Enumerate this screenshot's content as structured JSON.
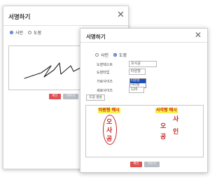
{
  "back_dialog": {
    "title": "서명하기",
    "radio_sign": "사인",
    "radio_stamp": "도장",
    "confirm_label": "확인",
    "clear_label": "지우기"
  },
  "front_dialog": {
    "title": "서명하기",
    "radio_sign": "사인",
    "radio_stamp": "도장",
    "fields": {
      "stamp_text": {
        "label": "도장텍스트",
        "value": "오사공"
      },
      "stamp_type": {
        "label": "도장타입",
        "value": "타원형"
      },
      "width": {
        "label": "가로사이즈"
      },
      "height": {
        "label": "세로사이즈",
        "value": "120"
      }
    },
    "type_options": [
      "타원형",
      "사각형"
    ],
    "generate_label": "도장 생성",
    "example_oval_label": "타원형 예시",
    "example_rect_label": "사각형 예시",
    "oval_chars": [
      "오",
      "사",
      "공"
    ],
    "rect_chars": [
      "오",
      "사",
      "공",
      "인"
    ],
    "confirm_label": "확인",
    "clear_label": "지우기"
  },
  "colors": {
    "accent_blue": "#2b63c6",
    "confirm_red": "#e05050",
    "clear_gray": "#b8bcc3",
    "seal_red": "#c62828",
    "highlight_yellow": "#f4f24a"
  }
}
